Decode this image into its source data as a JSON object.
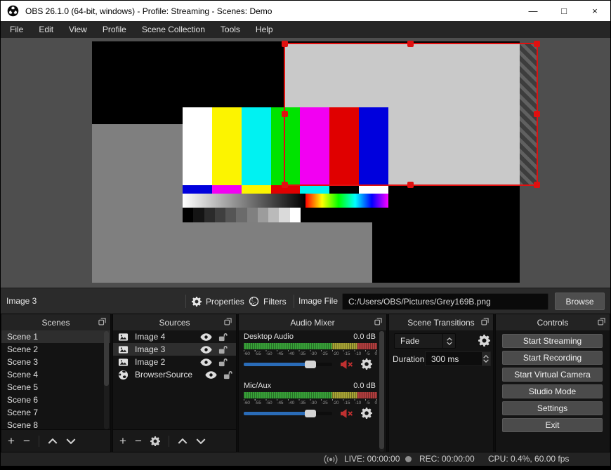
{
  "window": {
    "title": "OBS 26.1.0 (64-bit, windows) - Profile: Streaming - Scenes: Demo",
    "controls": {
      "minimize": "—",
      "maximize": "□",
      "close": "×"
    }
  },
  "menu": {
    "items": [
      "File",
      "Edit",
      "View",
      "Profile",
      "Scene Collection",
      "Tools",
      "Help"
    ]
  },
  "scene": {
    "test_pattern": {
      "bars": [
        "#ffffff",
        "#fcf400",
        "#00f2f2",
        "#00e300",
        "#f200f2",
        "#e00000",
        "#0000dd"
      ],
      "small_bars": [
        "#0000dd",
        "#f200f2",
        "#fcf400",
        "#e00000",
        "#00f2f2",
        "#000000",
        "#ffffff"
      ],
      "grayscale_gradient": [
        "#ffffff",
        "#000000"
      ],
      "rainbow_gradient": [
        "#ff0000",
        "#ffff00",
        "#00ff00",
        "#00ffff",
        "#0000ff",
        "#ff00ff"
      ],
      "grayscale_steps": [
        "#000000",
        "#141414",
        "#2b2b2b",
        "#3f3f3f",
        "#555555",
        "#6b6b6b",
        "#808080",
        "#9c9c9c",
        "#bababa",
        "#dadada",
        "#ffffff"
      ]
    },
    "selection_color": "#e01010"
  },
  "source_toolbar": {
    "source_name": "Image 3",
    "properties_label": "Properties",
    "filters_label": "Filters",
    "image_file_label": "Image File",
    "image_file_path": "C:/Users/OBS/Pictures/Grey169B.png",
    "browse_label": "Browse"
  },
  "docks": {
    "toolbar": {
      "add": "+",
      "remove": "−"
    },
    "scenes": {
      "title": "Scenes",
      "items": [
        {
          "label": "Scene 1",
          "selected": true
        },
        {
          "label": "Scene 2"
        },
        {
          "label": "Scene 3"
        },
        {
          "label": "Scene 4"
        },
        {
          "label": "Scene 5"
        },
        {
          "label": "Scene 6"
        },
        {
          "label": "Scene 7"
        },
        {
          "label": "Scene 8"
        }
      ]
    },
    "sources": {
      "title": "Sources",
      "items": [
        {
          "label": "Image 4",
          "icon": "image"
        },
        {
          "label": "Image 3",
          "icon": "image",
          "selected": true
        },
        {
          "label": "Image 2",
          "icon": "image"
        },
        {
          "label": "BrowserSource",
          "icon": "globe"
        }
      ]
    },
    "audio_mixer": {
      "title": "Audio Mixer",
      "ticks": [
        "-60",
        "-55",
        "-50",
        "-45",
        "-40",
        "-35",
        "-30",
        "-25",
        "-20",
        "-15",
        "-10",
        "-5",
        "0"
      ],
      "channels": [
        {
          "name": "Desktop Audio",
          "level": "0.0 dB"
        },
        {
          "name": "Mic/Aux",
          "level": "0.0 dB"
        }
      ],
      "slider_color": "#2a6cb8",
      "meter_colors": {
        "green": "#38a038",
        "yellow": "#a8a435",
        "red": "#b03e3e"
      }
    },
    "transitions": {
      "title": "Scene Transitions",
      "transition": "Fade",
      "duration_label": "Duration",
      "duration_value": "300 ms"
    },
    "controls": {
      "title": "Controls",
      "buttons": [
        "Start Streaming",
        "Start Recording",
        "Start Virtual Camera",
        "Studio Mode",
        "Settings",
        "Exit"
      ]
    }
  },
  "status_bar": {
    "live": "LIVE: 00:00:00",
    "rec": "REC: 00:00:00",
    "cpu": "CPU: 0.4%, 60.00 fps"
  }
}
